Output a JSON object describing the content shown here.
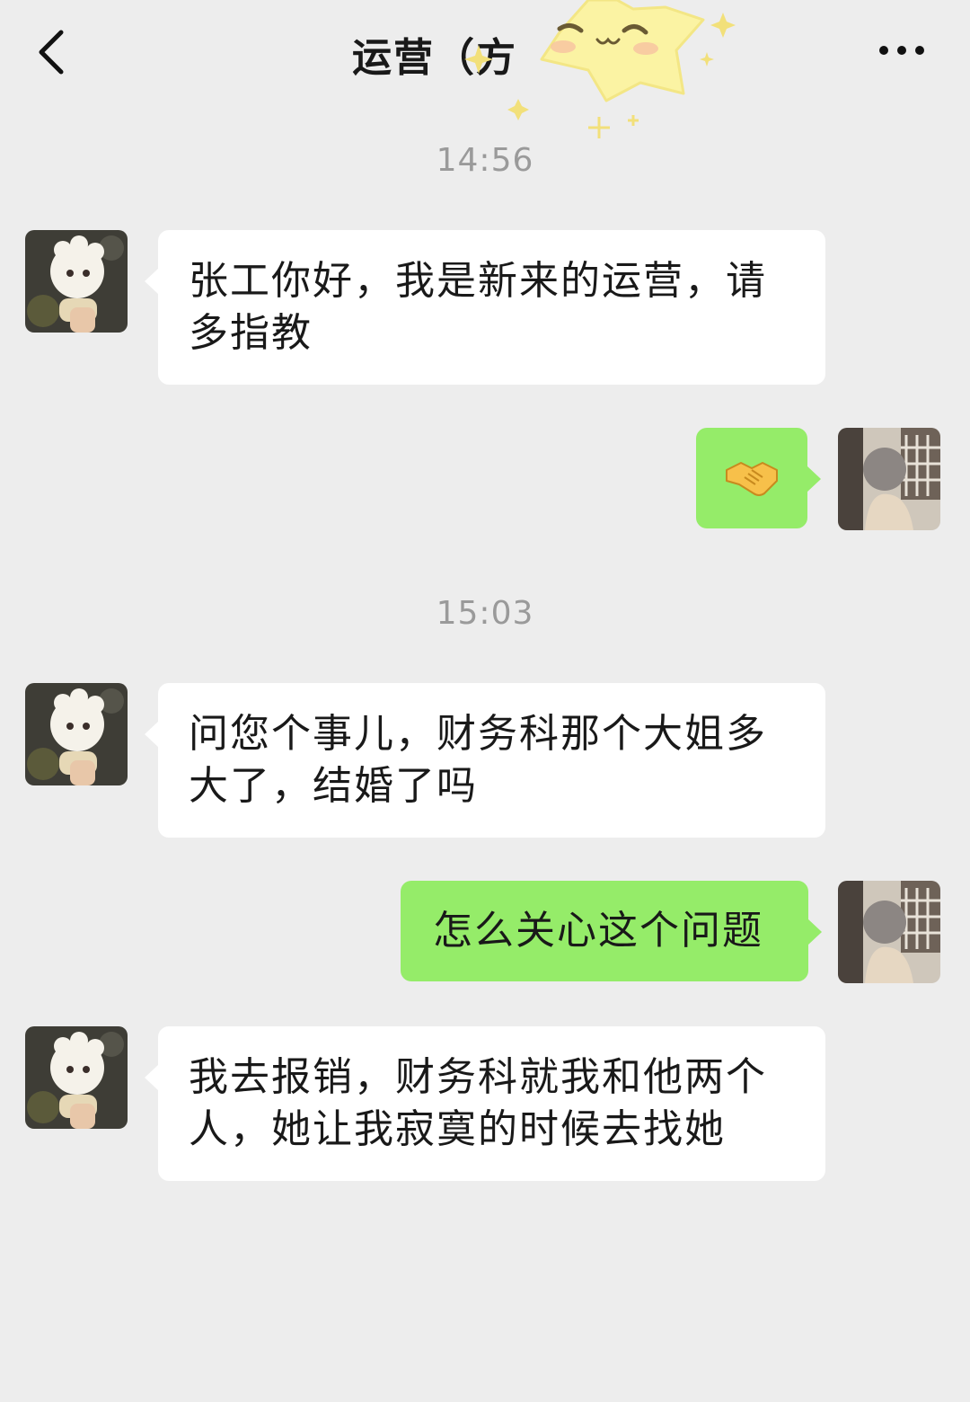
{
  "header": {
    "title": "运营（方",
    "back_icon": "chevron-left-icon",
    "more_icon": "more-dots-icon"
  },
  "sticker": {
    "icon": "smiling-star-sticker"
  },
  "colors": {
    "background": "#ededed",
    "incoming_bubble": "#ffffff",
    "outgoing_bubble": "#95ec69",
    "timestamp_text": "#9a9a9a"
  },
  "chat": {
    "timestamps": [
      "14:56",
      "15:03"
    ],
    "messages": [
      {
        "sender": "other",
        "text": "张工你好，我是新来的运营，请多指教"
      },
      {
        "sender": "me",
        "emoji": "handshake-emoji"
      },
      {
        "sender": "other",
        "text": "问您个事儿，财务科那个大姐多大了，结婚了吗"
      },
      {
        "sender": "me",
        "text": "怎么关心这个问题"
      },
      {
        "sender": "other",
        "text": "我去报销，财务科就我和他两个人，她让我寂寞的时候去找她"
      }
    ]
  }
}
